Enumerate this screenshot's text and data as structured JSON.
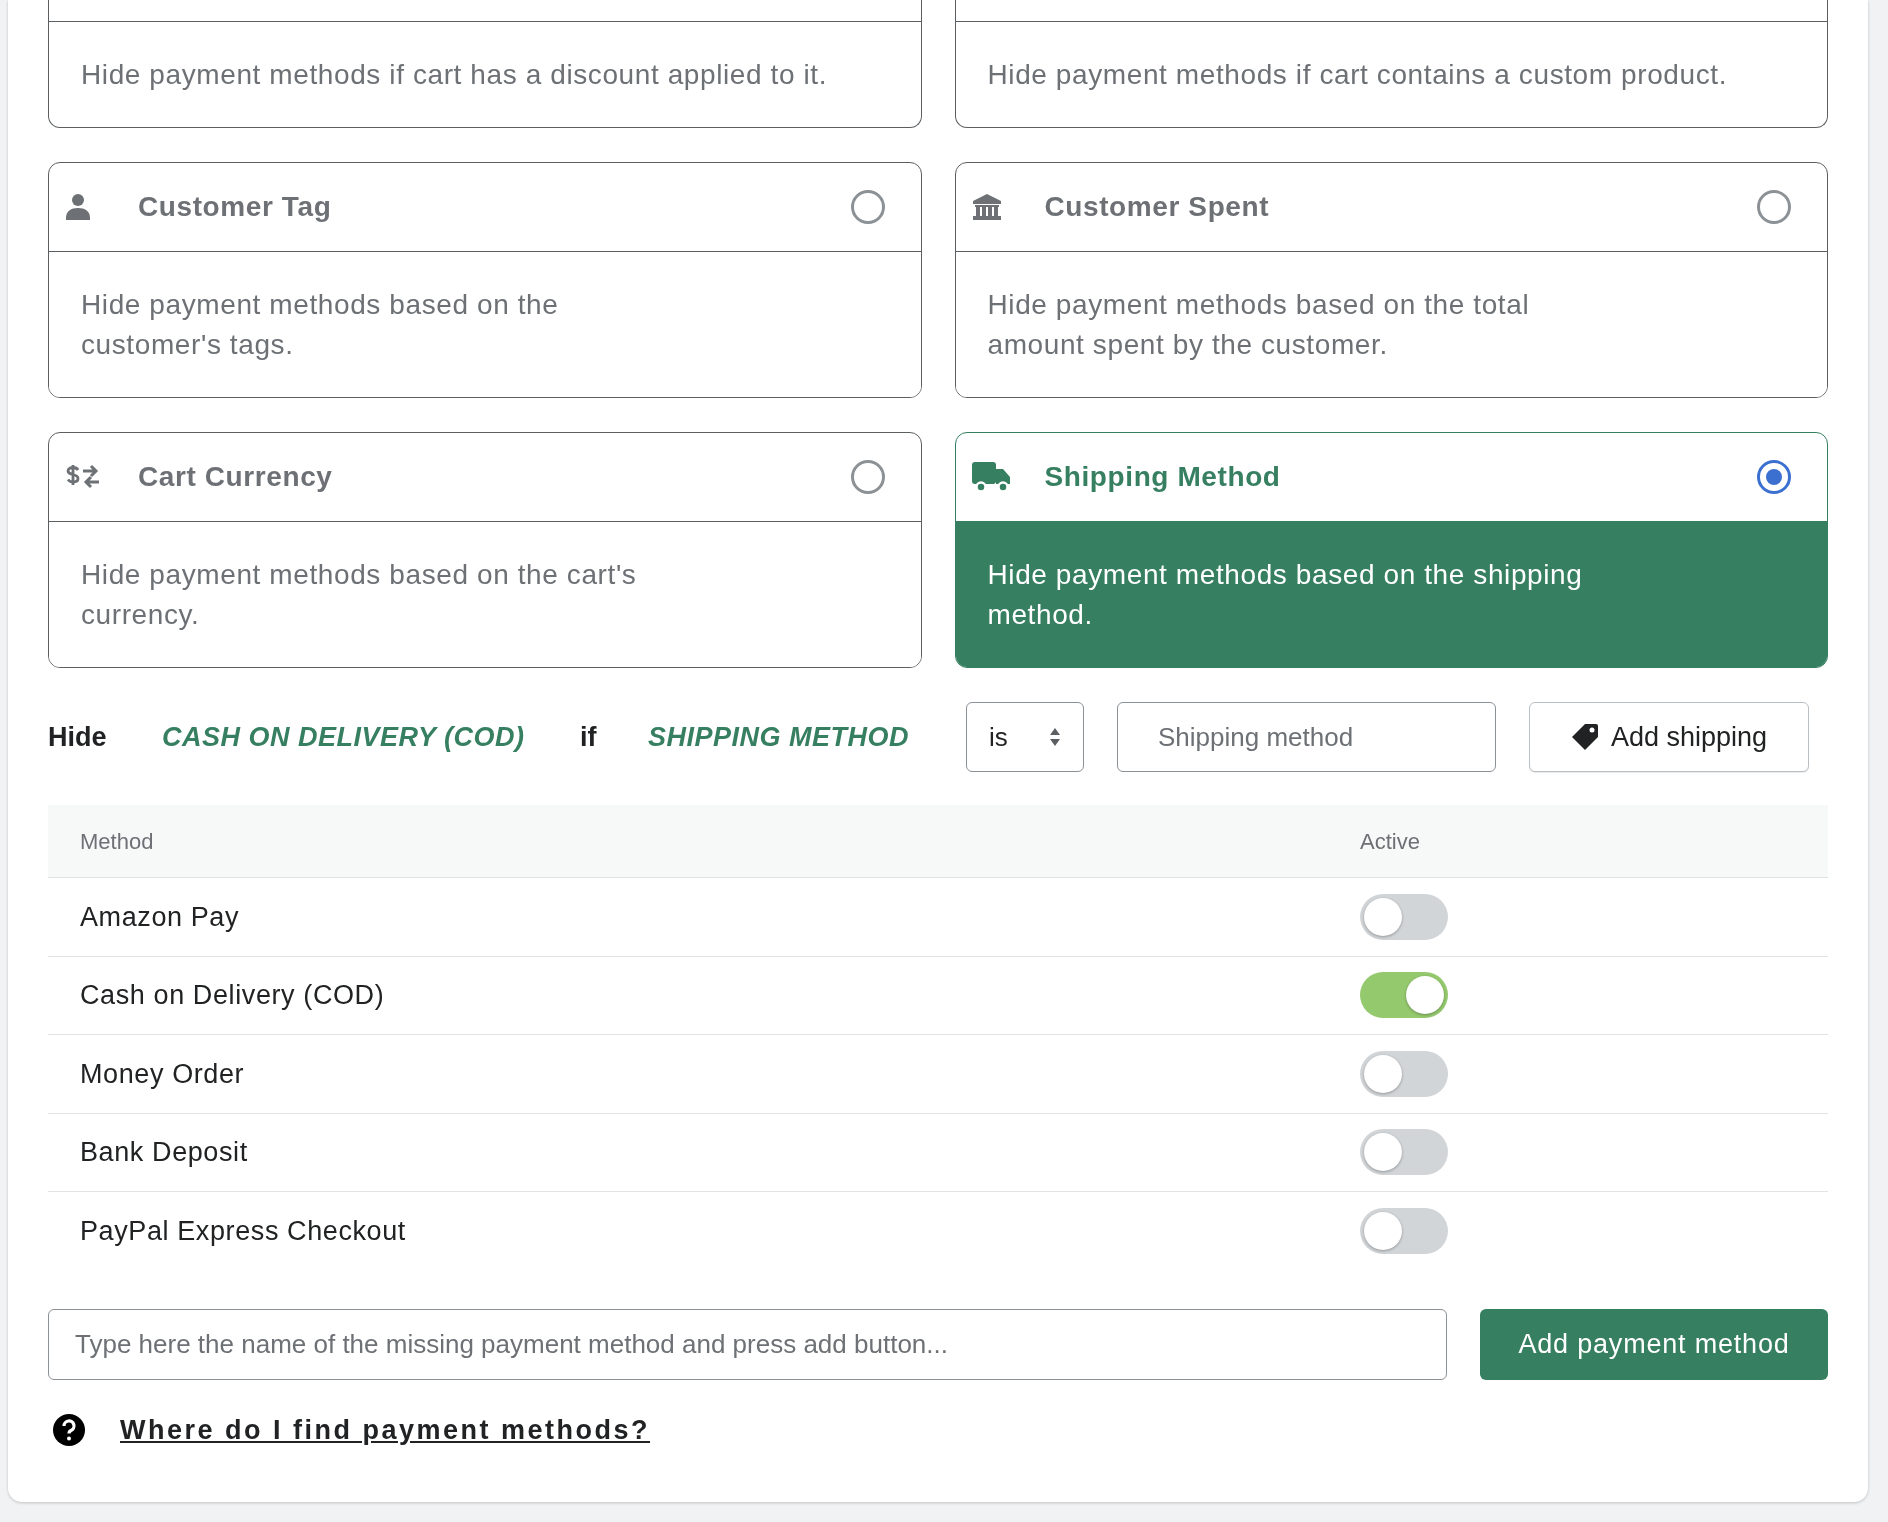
{
  "partial_cards": [
    {
      "description": "Hide payment methods if cart has a discount applied to it."
    },
    {
      "description": "Hide payment methods if cart contains a custom product."
    }
  ],
  "condition_cards": [
    {
      "kind": "person",
      "title": "Customer Tag",
      "description": "Hide payment methods based on the customer's tags.",
      "selected": false
    },
    {
      "kind": "bank",
      "title": "Customer Spent",
      "description": "Hide payment methods based on the total amount spent by the customer.",
      "selected": false
    },
    {
      "kind": "currency",
      "title": "Cart Currency",
      "description": "Hide payment methods based on the cart's currency.",
      "selected": false
    },
    {
      "kind": "truck",
      "title": "Shipping Method",
      "description": "Hide payment methods based on the shipping method.",
      "selected": true
    }
  ],
  "rule": {
    "hide_label": "Hide",
    "payment": "CASH ON DELIVERY (COD)",
    "if_label": "if",
    "condition": "SHIPPING METHOD",
    "operator": "is",
    "value_placeholder": "Shipping method",
    "add_button": "Add shipping"
  },
  "table": {
    "columns": [
      "Method",
      "Active"
    ],
    "rows": [
      {
        "method": "Amazon Pay",
        "active": false
      },
      {
        "method": "Cash on Delivery (COD)",
        "active": true
      },
      {
        "method": "Money Order",
        "active": false
      },
      {
        "method": "Bank Deposit",
        "active": false
      },
      {
        "method": "PayPal Express Checkout",
        "active": false
      }
    ]
  },
  "add_form": {
    "placeholder": "Type here the name of the missing payment method and press add button...",
    "button": "Add payment method"
  },
  "help_link": "Where do I find payment methods?"
}
